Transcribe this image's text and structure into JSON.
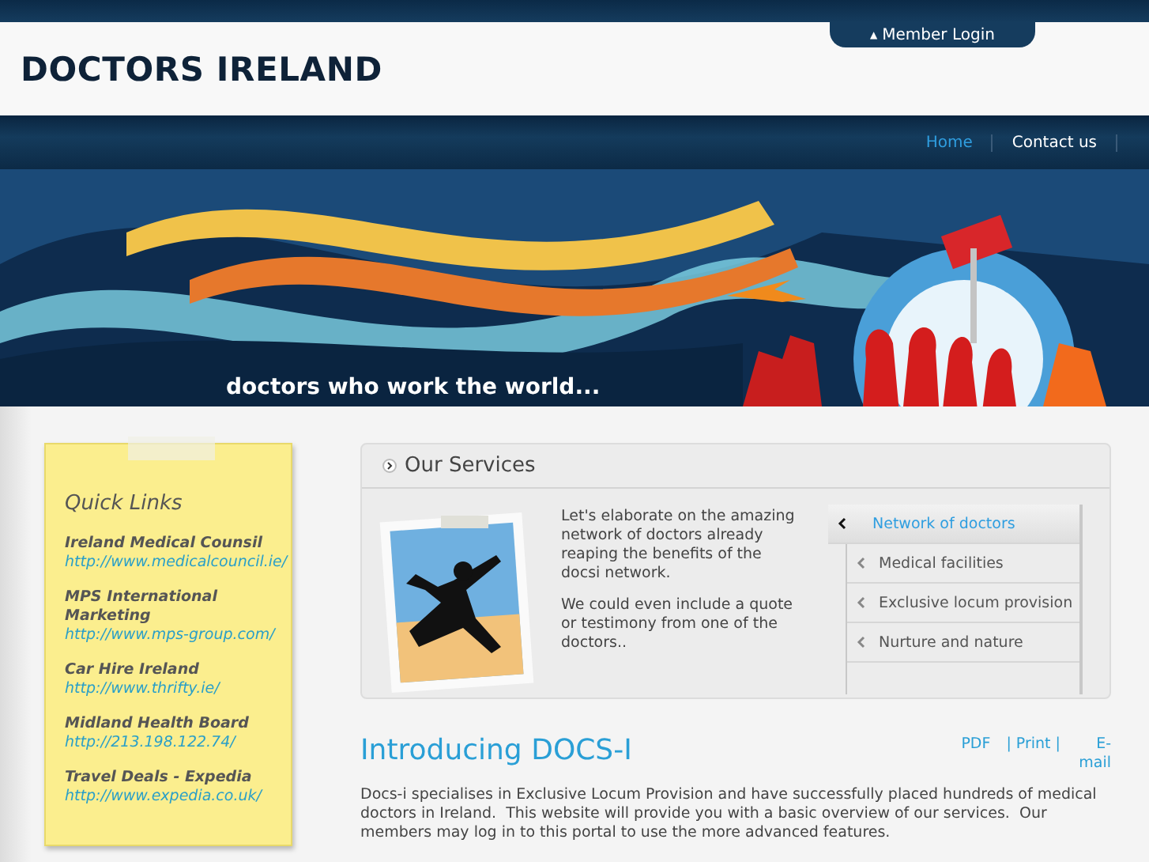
{
  "member_login": {
    "icon": "▲",
    "label": "Member Login"
  },
  "site_title": "DOCTORS IRELAND",
  "nav": [
    {
      "label": "Home",
      "selected": true
    },
    {
      "label": "Contact us",
      "selected": false
    }
  ],
  "banner": {
    "kind": "picture",
    "tagline": "doctors who work the world..."
  },
  "quick_links": {
    "title": "Quick Links",
    "items": [
      {
        "name": "Ireland Medical Counsil",
        "url": "http://www.medicalcouncil.ie/"
      },
      {
        "name": "MPS International Marketing",
        "url": "http://www.mps-group.com/"
      },
      {
        "name": "Car Hire Ireland",
        "url": "http://www.thrifty.ie/"
      },
      {
        "name": "Midland Health Board",
        "url": "http://213.198.122.74/"
      },
      {
        "name": "Travel Deals - Expedia",
        "url": "http://www.expedia.co.uk/"
      }
    ]
  },
  "services": {
    "title": "Our Services",
    "paragraphs": [
      "Let's elaborate on the amazing network of doctors already reaping the benefits of the docsi network.",
      "We could even include a quote or testimony from one of the doctors.."
    ],
    "menu": [
      {
        "label": "Network of doctors",
        "selected": true
      },
      {
        "label": "Medical facilities",
        "selected": false
      },
      {
        "label": "Exclusive locum provision",
        "selected": false
      },
      {
        "label": "Nurture and nature",
        "selected": false
      }
    ]
  },
  "article": {
    "title": "Introducing DOCS-I",
    "actions": [
      {
        "label": "PDF"
      },
      {
        "label": "| Print |"
      },
      {
        "label": "E-mail"
      }
    ],
    "body": "Docs-i specialises in Exclusive Locum Provision and have successfully placed hundreds of medical doctors in Ireland.  This website will provide you with a basic overview of our services.  Our members may log in to this portal to use the more advanced features."
  }
}
